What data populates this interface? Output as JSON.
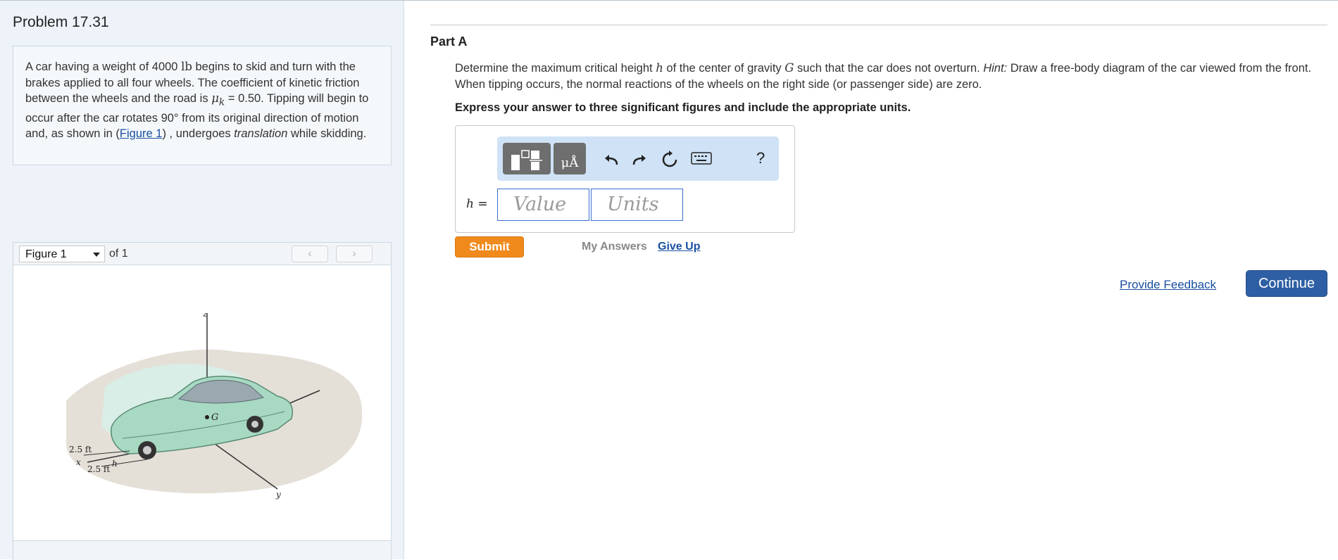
{
  "problem": {
    "title": "Problem 17.31",
    "text_1": "A car having a weight of 4000 ",
    "weight_unit": "lb",
    "text_2": " begins to skid and turn with the brakes applied to all four wheels. The coefficient of kinetic friction between the wheels and the road is ",
    "mu_symbol": "μ",
    "mu_sub": "k",
    "text_3": " = 0.50. Tipping will begin to occur after the car rotates 90° from its original direction of motion and, as shown in (",
    "figure_link": "Figure 1",
    "text_4": ") , undergoes ",
    "translation_word": "translation",
    "text_5": " while skidding."
  },
  "figure": {
    "selected": "Figure 1",
    "of_label": "of 1",
    "prev_icon": "chevron-left-icon",
    "next_icon": "chevron-right-icon",
    "labels": {
      "z": "z",
      "x": "x",
      "y": "y",
      "G": "G",
      "h": "h",
      "dim_1": "2.5 ft",
      "dim_2": "2.5 ft"
    }
  },
  "part": {
    "title": "Part A",
    "question_1": "Determine the maximum critical height ",
    "var_h": "h",
    "question_2": " of the center of gravity ",
    "var_G": "G",
    "question_3": " such that the car does not overturn. ",
    "hint_label": "Hint:",
    "question_4": " Draw a free-body diagram of the car viewed from the front. When tipping occurs, the normal reactions of the wheels on the right side (or passenger side) are zero.",
    "instruction": "Express your answer to three significant figures and include the appropriate units."
  },
  "answer": {
    "toolbar": {
      "templates_icon": "templates-icon",
      "units_icon": "units-icon",
      "units_glyph": "μÅ",
      "undo_icon": "undo-icon",
      "redo_icon": "redo-icon",
      "reset_icon": "reset-icon",
      "keyboard_icon": "keyboard-icon",
      "help_label": "?"
    },
    "label": "h =",
    "value_placeholder": "Value",
    "units_placeholder": "Units"
  },
  "actions": {
    "submit": "Submit",
    "my_answers": "My Answers",
    "give_up": "Give Up",
    "feedback": "Provide Feedback",
    "continue": "Continue"
  },
  "colors": {
    "accent_orange": "#f08a1c",
    "accent_blue": "#2e5fa4",
    "toolbar_bg": "#cfe2f6",
    "link": "#1a4fa0"
  }
}
